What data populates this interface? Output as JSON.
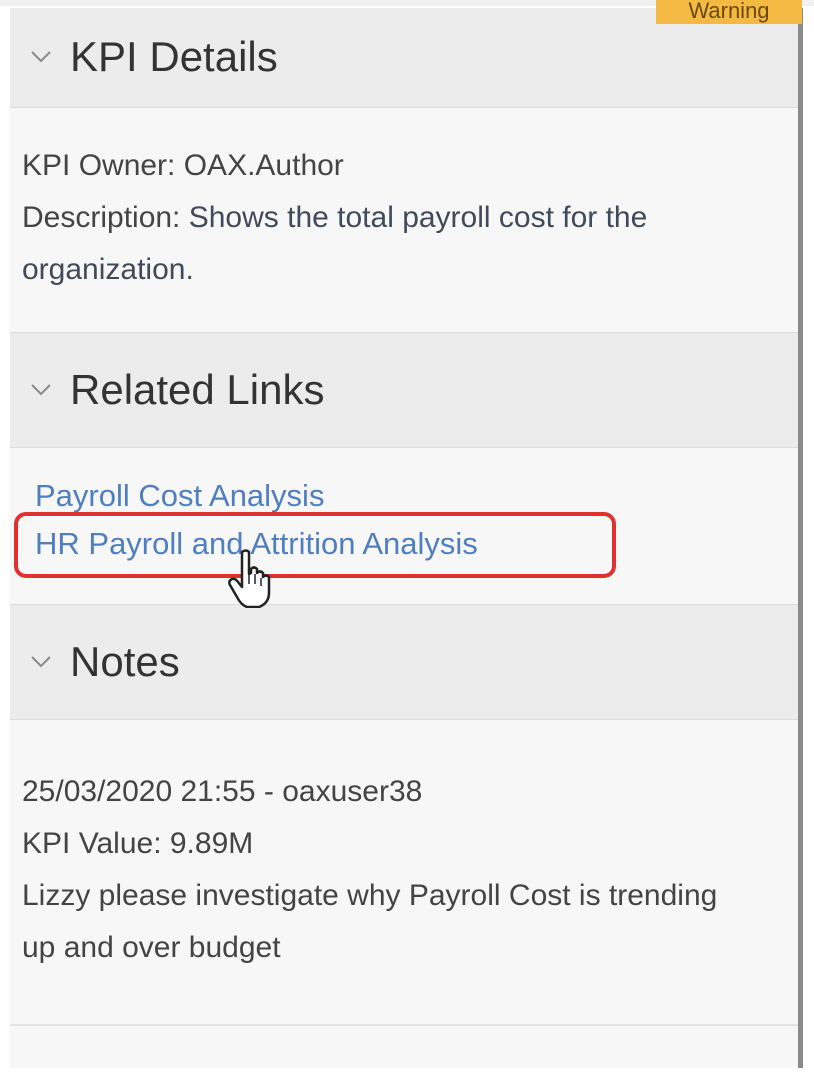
{
  "status_badge": {
    "label": "Warning"
  },
  "sections": {
    "kpi_details": {
      "title": "KPI Details",
      "owner_line": "KPI Owner: OAX.Author",
      "description_label": "Description: ",
      "description_value": "Shows the total payroll cost for the organization."
    },
    "related_links": {
      "title": "Related Links",
      "links": [
        {
          "label": "Payroll Cost Analysis"
        },
        {
          "label": "HR Payroll and Attrition Analysis"
        }
      ]
    },
    "notes": {
      "title": "Notes",
      "entries": [
        {
          "header": "25/03/2020 21:55 - oaxuser38",
          "kpi_value": "KPI Value: 9.89M",
          "text": "Lizzy please investigate why Payroll Cost is trending up and over budget"
        }
      ]
    }
  },
  "annotations": {
    "highlight_color": "#e0312f",
    "link_color": "#4f7fc0",
    "cursor_icon": "hand-pointer-icon"
  }
}
